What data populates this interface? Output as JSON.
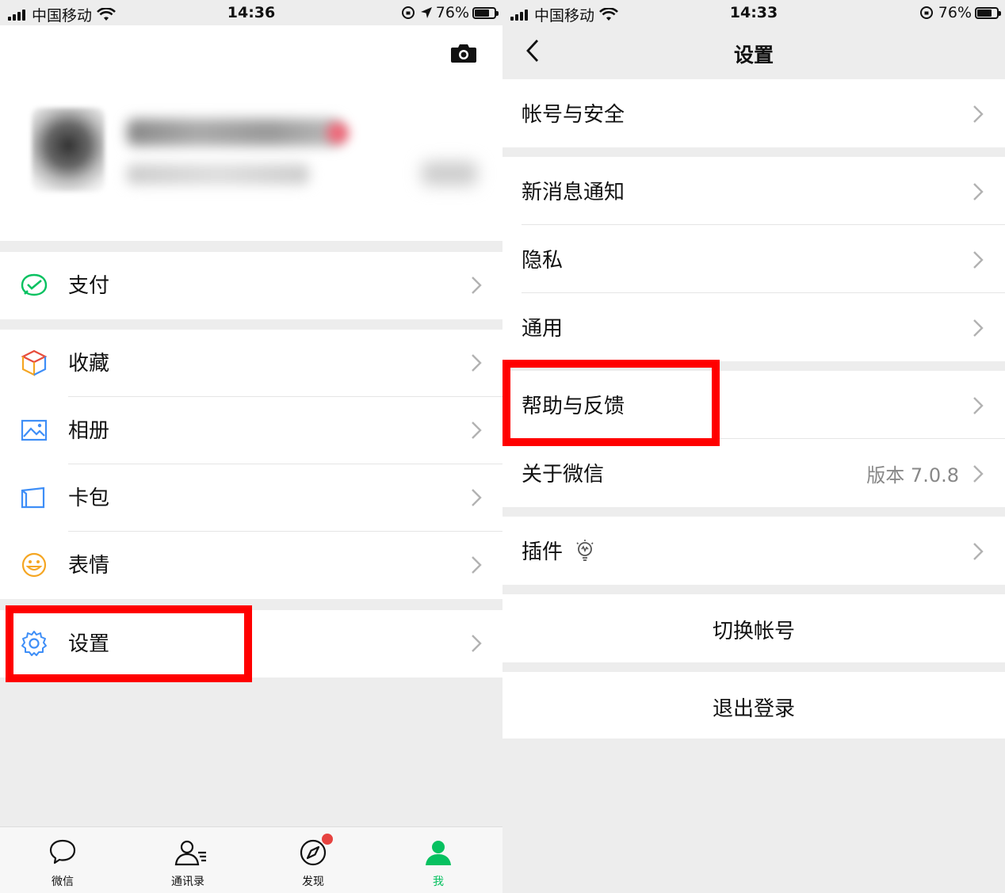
{
  "left": {
    "status": {
      "carrier": "中国移动",
      "time": "14:36",
      "battery": "76%"
    },
    "menu": [
      {
        "label": "支付",
        "icon": "pay-icon"
      },
      {
        "label": "收藏",
        "icon": "favorites-icon"
      },
      {
        "label": "相册",
        "icon": "album-icon"
      },
      {
        "label": "卡包",
        "icon": "card-wallet-icon"
      },
      {
        "label": "表情",
        "icon": "sticker-icon"
      },
      {
        "label": "设置",
        "icon": "settings-gear-icon"
      }
    ],
    "tabs": [
      {
        "label": "微信",
        "icon": "chat-icon"
      },
      {
        "label": "通讯录",
        "icon": "contacts-icon"
      },
      {
        "label": "发现",
        "icon": "discover-compass-icon"
      },
      {
        "label": "我",
        "icon": "me-person-icon"
      }
    ],
    "colors": {
      "active_tab": "#07c160",
      "badge": "#e64340",
      "highlight": "#ff0000"
    }
  },
  "right": {
    "status": {
      "carrier": "中国移动",
      "time": "14:33",
      "battery": "76%"
    },
    "title": "设置",
    "items": [
      {
        "label": "帐号与安全"
      },
      {
        "label": "新消息通知"
      },
      {
        "label": "隐私"
      },
      {
        "label": "通用"
      },
      {
        "label": "帮助与反馈"
      },
      {
        "label": "关于微信",
        "value": "版本 7.0.8"
      },
      {
        "label": "插件"
      }
    ],
    "switch_account": "切换帐号",
    "logout": "退出登录"
  }
}
